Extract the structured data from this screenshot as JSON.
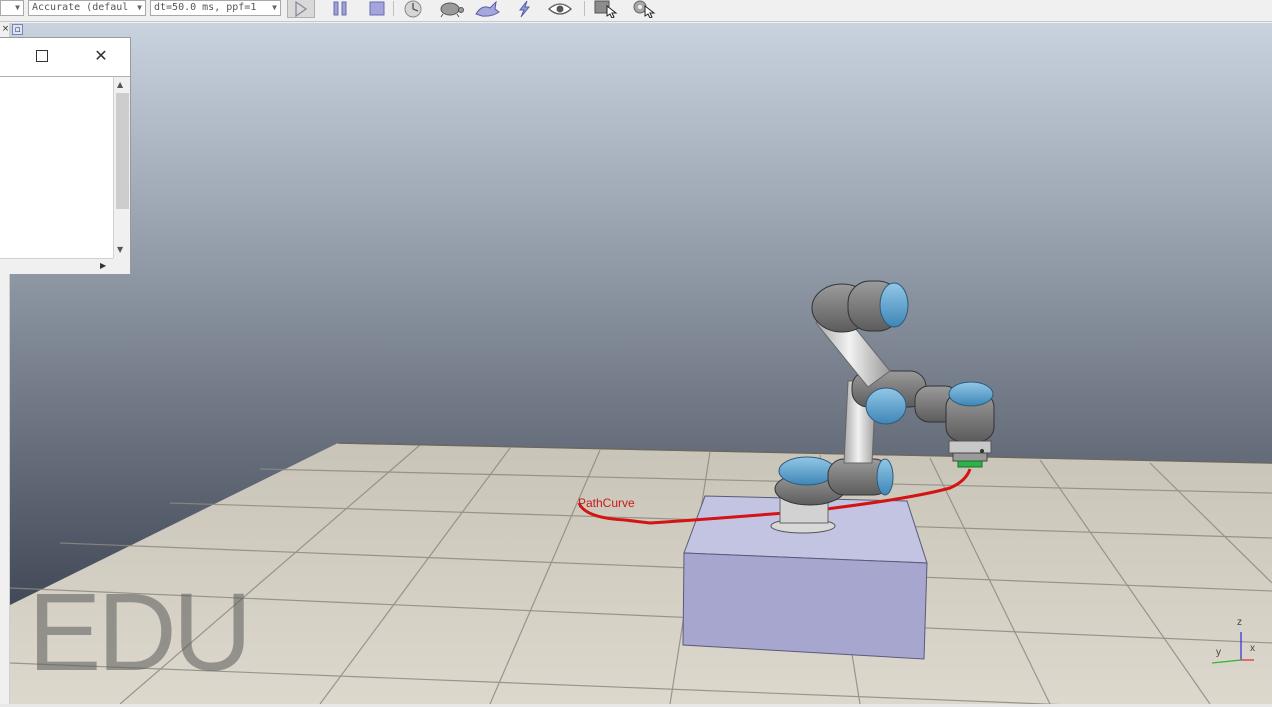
{
  "toolbar": {
    "engine_select_value": "Accurate (defaul",
    "timestep_select_value": "dt=50.0 ms, ppf=1",
    "buttons": {
      "start": "play-icon",
      "pause": "pause-icon",
      "stop": "stop-icon",
      "realtime": "clock-icon",
      "slower": "turtle-icon",
      "faster": "rabbit-icon",
      "thread": "lightning-icon",
      "visualization": "eye-icon",
      "page_select": "page-cursor-icon",
      "scene_select": "gear-cursor-icon"
    }
  },
  "viewport": {
    "path_label": "PathCurve",
    "watermark": "EDU",
    "axes": {
      "x": "x",
      "y": "y",
      "z": "z"
    },
    "colors": {
      "sky_top": "#c9d3df",
      "sky_bottom": "#2b3140",
      "path": "#d41414",
      "robot_accent": "#5fa7d6",
      "robot_gray": "#7b7b7b",
      "box": "#a6a6cf"
    }
  }
}
